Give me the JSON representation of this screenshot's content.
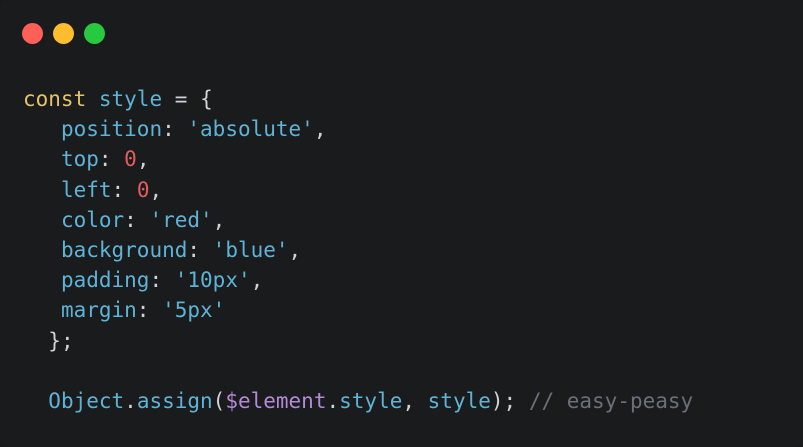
{
  "window": {
    "controls": [
      {
        "name": "close",
        "color": "#fe5f57"
      },
      {
        "name": "minimize",
        "color": "#febc2e"
      },
      {
        "name": "maximize",
        "color": "#28c840"
      }
    ]
  },
  "code": {
    "line1": {
      "kw": "const",
      "var": "style",
      "op": "=",
      "brace": "{"
    },
    "props": [
      {
        "key": "position",
        "value": "'absolute'",
        "type": "str"
      },
      {
        "key": "top",
        "value": "0",
        "type": "num"
      },
      {
        "key": "left",
        "value": "0",
        "type": "num"
      },
      {
        "key": "color",
        "value": "'red'",
        "type": "str"
      },
      {
        "key": "background",
        "value": "'blue'",
        "type": "str"
      },
      {
        "key": "padding",
        "value": "'10px'",
        "type": "str"
      },
      {
        "key": "margin",
        "value": "'5px'",
        "type": "str"
      }
    ],
    "close": "};",
    "call": {
      "object": "Object",
      "method": "assign",
      "arg1_var": "$element",
      "arg1_prop": "style",
      "arg2": "style",
      "comment": "// easy-peasy"
    }
  }
}
